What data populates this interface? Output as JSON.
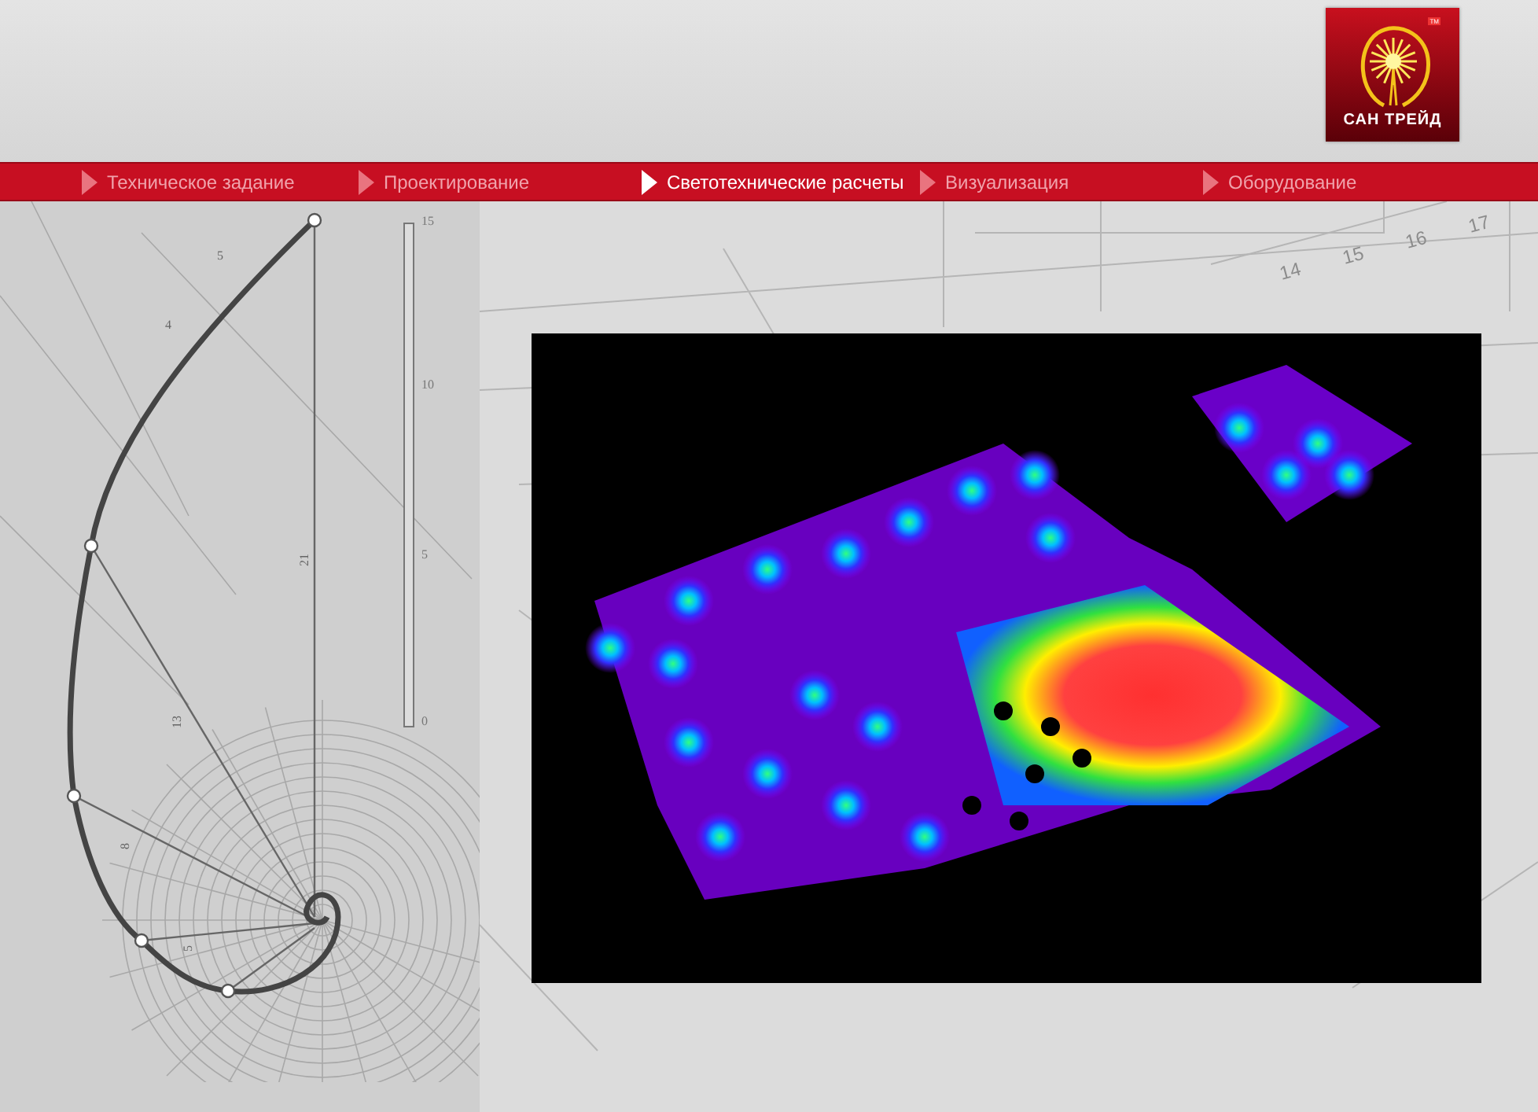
{
  "logo": {
    "name": "САН ТРЕЙД",
    "tm": "TM"
  },
  "nav": [
    {
      "label": "Техническое задание",
      "selected": false
    },
    {
      "label": "Проектирование",
      "selected": false
    },
    {
      "label": "Светотехнические расчеты",
      "selected": true
    },
    {
      "label": "Визуализация",
      "selected": false
    },
    {
      "label": "Оборудование",
      "selected": false
    }
  ],
  "spiral_drawing": {
    "scale_labels": [
      "15",
      "10",
      "5",
      "0"
    ],
    "segment_labels": [
      "5",
      "4",
      "21",
      "13",
      "8",
      "5"
    ]
  },
  "blueprint_ruler_labels": [
    "14",
    "15",
    "16",
    "17"
  ]
}
